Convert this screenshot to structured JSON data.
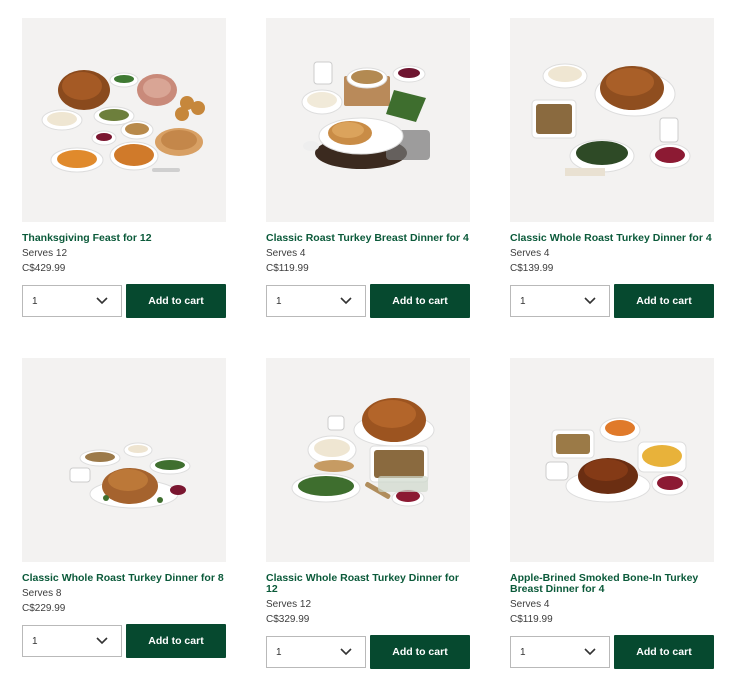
{
  "products": [
    {
      "title": "Thanksgiving Feast for 12",
      "serves": "Serves 12",
      "price": "C$429.99",
      "quantity": "1",
      "button_label": "Add to cart"
    },
    {
      "title": "Classic Roast Turkey Breast Dinner for 4",
      "serves": "Serves 4",
      "price": "C$119.99",
      "quantity": "1",
      "button_label": "Add to cart"
    },
    {
      "title": "Classic Whole Roast Turkey Dinner for 4",
      "serves": "Serves 4",
      "price": "C$139.99",
      "quantity": "1",
      "button_label": "Add to cart"
    },
    {
      "title": "Classic Whole Roast Turkey Dinner for 8",
      "serves": "Serves 8",
      "price": "C$229.99",
      "quantity": "1",
      "button_label": "Add to cart"
    },
    {
      "title": "Classic Whole Roast Turkey Dinner for 12",
      "serves": "Serves 12",
      "price": "C$329.99",
      "quantity": "1",
      "button_label": "Add to cart"
    },
    {
      "title": "Apple-Brined Smoked Bone-In Turkey Breast Dinner for 4",
      "serves": "Serves 4",
      "price": "C$119.99",
      "quantity": "1",
      "button_label": "Add to cart"
    }
  ],
  "colors": {
    "brand_green": "#06492f",
    "title_green": "#0b5a3a",
    "image_background": "#f3f2f1"
  },
  "icons": {
    "quantity_dropdown": "chevron-down-icon"
  }
}
